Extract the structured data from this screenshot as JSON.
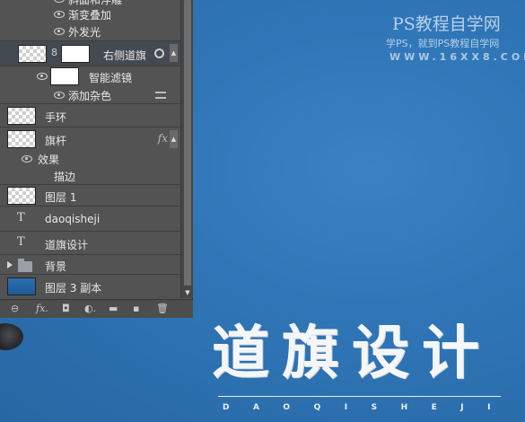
{
  "watermark": {
    "line1": "PS教程自学网",
    "line2": "学PS，就到PS教程自学网",
    "line3": "WWW.16XX8.COM"
  },
  "canvas_title": "道旗设计",
  "canvas_subtitle": "DAOQISHEJI",
  "layers": {
    "rows": [
      {
        "label": "斜面和浮雕"
      },
      {
        "label": "渐变叠加"
      },
      {
        "label": "外发光"
      },
      {
        "label": "右侧道旗"
      },
      {
        "label": "智能滤镜"
      },
      {
        "label": "添加杂色"
      },
      {
        "label": "手环"
      },
      {
        "label": "旗杆"
      },
      {
        "label": "效果"
      },
      {
        "label": "描边"
      },
      {
        "label": "图层 1"
      },
      {
        "label": "daoqisheji"
      },
      {
        "label": "道旗设计"
      },
      {
        "label": "背景"
      },
      {
        "label": "图层 3 副本"
      }
    ],
    "fx_label": "fx",
    "text_glyph": "T",
    "toolbar": {
      "link": "⊖",
      "fx": "fx.",
      "mask": "◘",
      "adjust": "◐.",
      "folder": "▬",
      "new": "▪",
      "delete": "🗑"
    }
  }
}
